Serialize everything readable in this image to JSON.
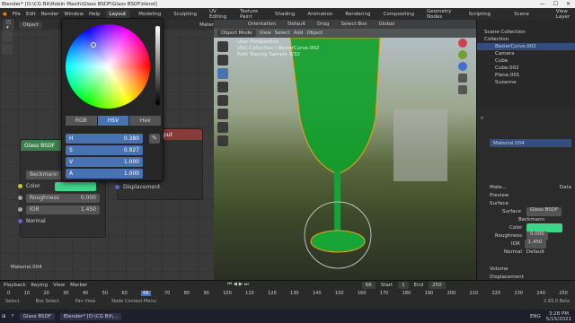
{
  "window": {
    "title": "Blender* [D:\\CG Bit\\Robin Masih\\Glass BSDF\\Glass BSDF.blend]"
  },
  "menubar": {
    "items": [
      "File",
      "Edit",
      "Render",
      "Window",
      "Help"
    ],
    "workspaces": [
      "Layout",
      "Modeling",
      "Sculpting",
      "UV Editing",
      "Texture Paint",
      "Shading",
      "Animation",
      "Rendering",
      "Compositing",
      "Geometry Nodes",
      "Scripting"
    ],
    "scene": "Scene",
    "view_layer": "View Layer"
  },
  "node_editor": {
    "mode": "Object",
    "slot": "Material.004"
  },
  "color_picker": {
    "tabs": [
      "RGB",
      "HSV",
      "Hex"
    ],
    "active_tab": "HSV",
    "h": {
      "label": "H",
      "value": "0.380"
    },
    "s": {
      "label": "S",
      "value": "0.927"
    },
    "v": {
      "label": "V",
      "value": "1.000"
    },
    "a": {
      "label": "A",
      "value": "1.000"
    }
  },
  "glass_node": {
    "title": "Glass BSDF",
    "distribution": "Beckmann",
    "color_label": "Color",
    "color_swatch": "#3fd48a",
    "roughness_label": "Roughness",
    "roughness_value": "0.000",
    "ior_label": "IOR",
    "ior_value": "1.450",
    "normal_label": "Normal"
  },
  "output_node": {
    "title": "Output",
    "displacement_label": "Displacement"
  },
  "viewport": {
    "mode": "Object Mode",
    "menus": [
      "View",
      "Select",
      "Add",
      "Object"
    ],
    "orientation": "Orientation",
    "default": "Default",
    "drag": "Drag",
    "select_box": "Select Box",
    "global": "Global",
    "info_line1": "User Perspective",
    "info_line2": "(66) Collection | BezierCurve.002",
    "info_line3": "Path Tracing Sample 3/32"
  },
  "outliner": {
    "title": "Scene Collection",
    "items": [
      "Collection",
      "BezierCurve.002",
      "Camera",
      "Cube",
      "Cube.002",
      "Plane.001",
      "Suzanne"
    ]
  },
  "properties": {
    "material": "Material.004",
    "material_name": "Mate...",
    "data": "Data",
    "preview": "Preview",
    "surface_header": "Surface",
    "surface_label": "Surface",
    "surface_value": "Glass BSDF",
    "distribution": "Beckmann",
    "color_label": "Color",
    "roughness_label": "Roughness",
    "roughness_value": "0.000",
    "ior_label": "IOR",
    "ior_value": "1.450",
    "normal_label": "Normal",
    "normal_value": "Default",
    "volume": "Volume",
    "displacement": "Displacement"
  },
  "timeline": {
    "menus": [
      "Playback",
      "Keying",
      "View",
      "Marker"
    ],
    "current": "66",
    "start_label": "Start",
    "start": "1",
    "end_label": "End",
    "end": "250",
    "ticks": [
      "0",
      "10",
      "20",
      "30",
      "40",
      "50",
      "60",
      "66",
      "70",
      "80",
      "90",
      "100",
      "110",
      "120",
      "130",
      "140",
      "150",
      "160",
      "170",
      "180",
      "190",
      "200",
      "210",
      "220",
      "230",
      "240",
      "250"
    ],
    "material": "Material.004"
  },
  "status": {
    "select": "Select",
    "box_select": "Box Select",
    "pan_view": "Pan View",
    "node_ctx": "Node Context Menu",
    "version": "2.93.0 Beta"
  },
  "taskbar": {
    "items": [
      "Glass BSDF",
      "Blender* [D:\\CG Bit\\..."
    ],
    "lang": "ENG",
    "time": "3:28 PM",
    "date": "5/15/2021"
  }
}
